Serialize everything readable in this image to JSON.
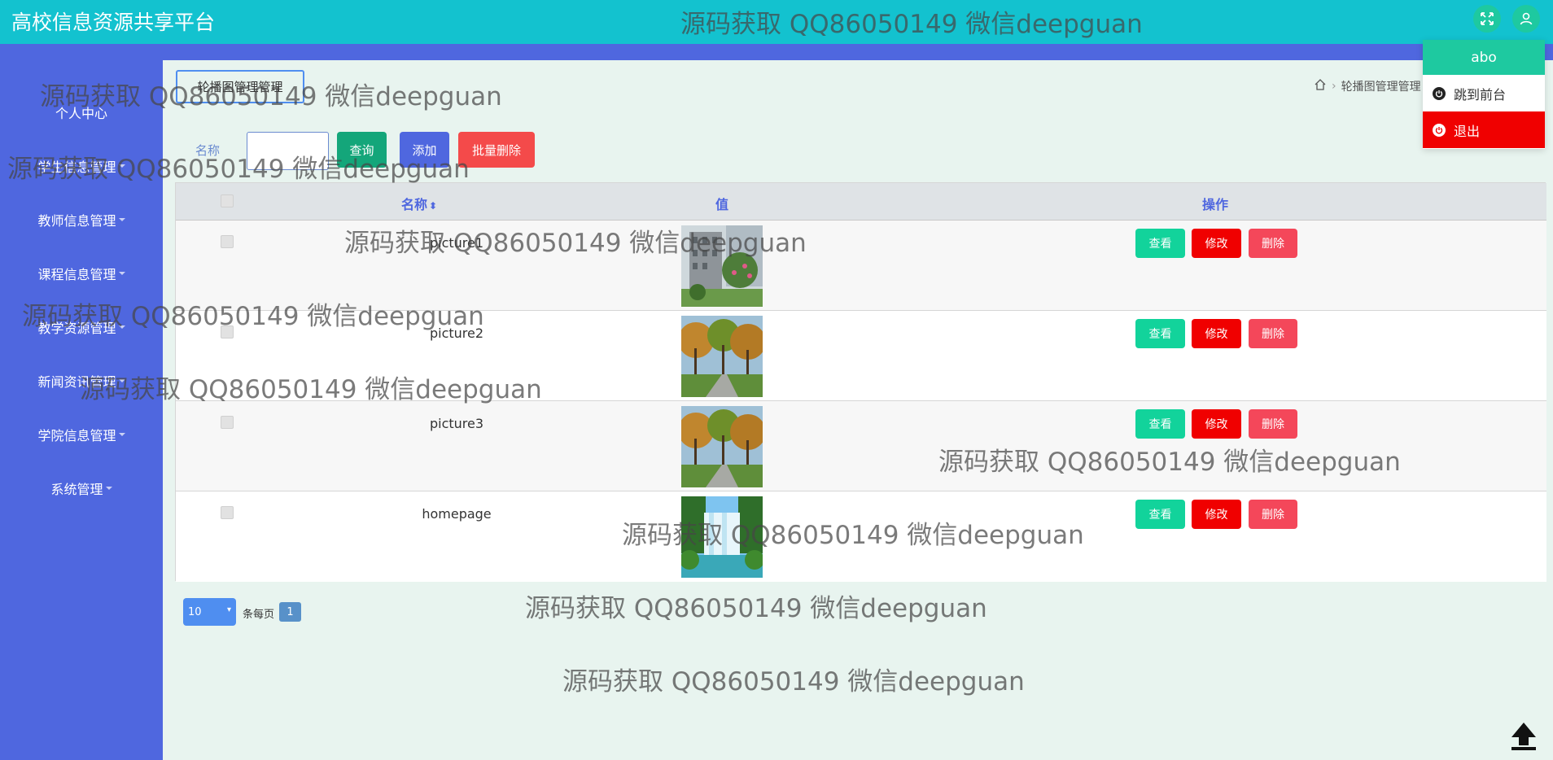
{
  "app": {
    "title": "高校信息资源共享平台"
  },
  "user": {
    "name": "abo"
  },
  "user_menu": {
    "items": [
      "跳到前台",
      "退出"
    ]
  },
  "sidebar": {
    "items": [
      {
        "label": "个人中心",
        "has_caret": false
      },
      {
        "label": "学生信息管理",
        "has_caret": true
      },
      {
        "label": "教师信息管理",
        "has_caret": true
      },
      {
        "label": "课程信息管理",
        "has_caret": true
      },
      {
        "label": "教学资源管理",
        "has_caret": true
      },
      {
        "label": "新闻资讯管理",
        "has_caret": true
      },
      {
        "label": "学院信息管理",
        "has_caret": true
      },
      {
        "label": "系统管理",
        "has_caret": true
      }
    ]
  },
  "page": {
    "title": "轮播图管理管理"
  },
  "breadcrumb": {
    "current": "轮播图管理管理"
  },
  "search": {
    "label": "名称",
    "value": "",
    "placeholder": ""
  },
  "toolbar": {
    "query_label": "查询",
    "add_label": "添加",
    "batch_delete_label": "批量删除"
  },
  "table": {
    "headers": {
      "name": "名称",
      "value": "值",
      "actions": "操作"
    },
    "rows": [
      {
        "name": "picture1",
        "image": "campus-building-photo"
      },
      {
        "name": "picture2",
        "image": "campus-trees-photo"
      },
      {
        "name": "picture3",
        "image": "campus-trees-photo"
      },
      {
        "name": "homepage",
        "image": "waterfall-photo"
      }
    ],
    "row_actions": {
      "view": "查看",
      "edit": "修改",
      "delete": "删除"
    }
  },
  "pagination": {
    "page_size": "10",
    "per_page_label": "条每页",
    "current_page": "1"
  },
  "watermark": {
    "text": "源码获取 QQ86050149 微信deepguan"
  },
  "icons": {
    "fullscreen": "fullscreen-icon",
    "user": "user-icon",
    "home": "home-icon",
    "sort": "sort-icon",
    "power": "power-icon",
    "back_to_top": "arrow-up-icon"
  },
  "colors": {
    "header": "#13c2cf",
    "sidebar": "#4f67df",
    "view_button": "#12d39b",
    "edit_button": "#f00000",
    "delete_button": "#f4475a",
    "query_button": "#14a67a",
    "add_button": "#4f67df",
    "batch_delete_button": "#f44a4a",
    "dropdown_header": "#1ec9a0",
    "logout_item": "#f00000"
  }
}
